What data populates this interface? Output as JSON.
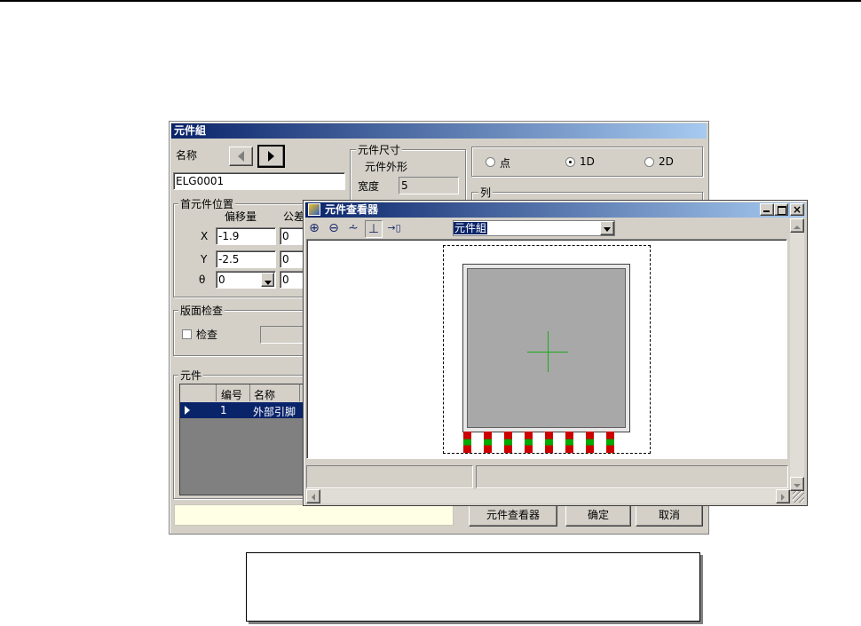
{
  "dialog": {
    "title": "元件組",
    "name_label": "名称",
    "name_value": "ELG0001",
    "first_pos": {
      "legend": "首元件位置",
      "offset_header": "偏移量",
      "tolerance_header": "公差",
      "rows": [
        {
          "label": "X",
          "offset": "-1.9",
          "tol": "0"
        },
        {
          "label": "Y",
          "offset": "-2.5",
          "tol": "0"
        },
        {
          "label": "θ",
          "offset": "0",
          "tol": "0"
        }
      ]
    },
    "size": {
      "legend": "元件尺寸",
      "shape_label": "元件外形",
      "width_label": "宽度",
      "width_value": "5"
    },
    "mode": {
      "options": [
        "点",
        "1D",
        "2D"
      ],
      "selected": "1D"
    },
    "column_legend": "列",
    "board_check": {
      "legend": "版面检查",
      "checkbox_label": "检查"
    },
    "components": {
      "legend": "元件",
      "headers": [
        "编号",
        "名称"
      ],
      "rows": [
        {
          "no": "1",
          "name": "外部引脚"
        }
      ]
    },
    "buttons": {
      "viewer": "元件查看器",
      "ok": "确定",
      "cancel": "取消"
    }
  },
  "viewer": {
    "title": "元件查看器",
    "dropdown_value": "元件組",
    "toolbar_icons": [
      "zoom-in-icon",
      "zoom-out-icon",
      "filter-icon",
      "pin-icon",
      "export-icon"
    ],
    "colors": {
      "body": "#a8a8a8",
      "crosshair": "#1aaa1a",
      "pad_red": "#cc0000",
      "pad_green": "#00aa00"
    }
  }
}
